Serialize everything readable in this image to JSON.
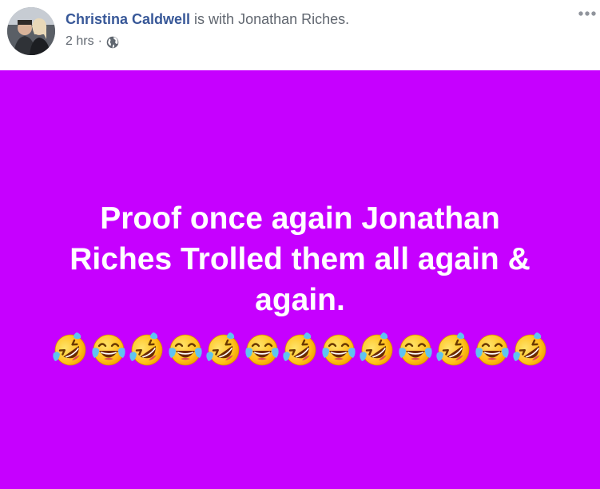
{
  "post": {
    "author": "Christina Caldwell",
    "with_text": " is with ",
    "tagged": "Jonathan Riches",
    "tagged_suffix": ".",
    "timestamp": "2 hrs",
    "separator": "·",
    "privacy_icon": "globe-icon",
    "more_icon": "more-options-icon",
    "body_line_1": "Proof once again Jonathan",
    "body_line_2": "Riches Trolled them all again &",
    "body_line_3": "again.",
    "emoji_sequence": [
      "rolling-on-floor-laughing",
      "face-with-tears-of-joy",
      "rolling-on-floor-laughing",
      "face-with-tears-of-joy",
      "rolling-on-floor-laughing",
      "face-with-tears-of-joy",
      "rolling-on-floor-laughing",
      "face-with-tears-of-joy",
      "rolling-on-floor-laughing",
      "face-with-tears-of-joy",
      "rolling-on-floor-laughing",
      "face-with-tears-of-joy",
      "rolling-on-floor-laughing"
    ]
  },
  "colors": {
    "background": "#c600ff",
    "text": "#ffffff",
    "author_link": "#385898",
    "meta": "#606770"
  }
}
